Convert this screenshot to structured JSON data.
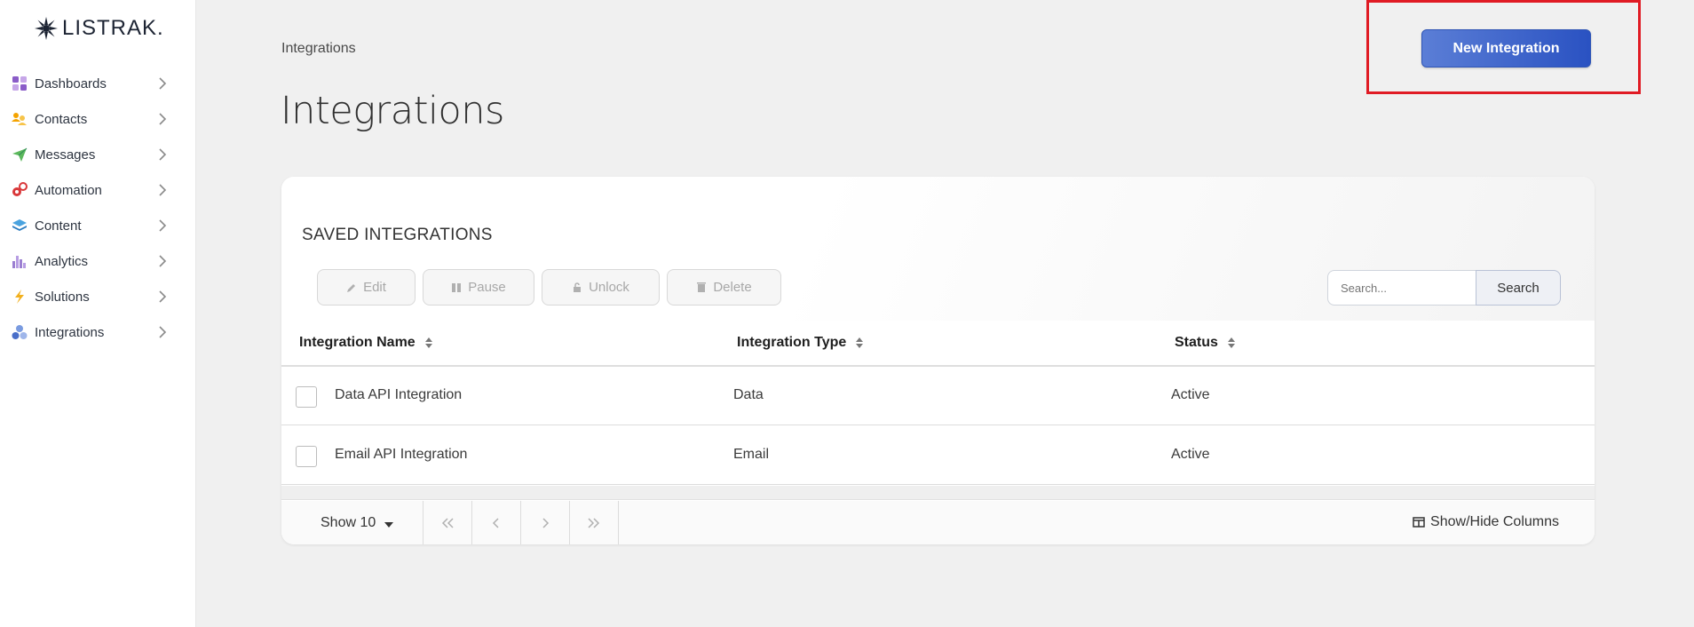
{
  "brand": {
    "name": "LISTRAK."
  },
  "sidebar": {
    "items": [
      {
        "label": "Dashboards",
        "icon": "dashboards-icon"
      },
      {
        "label": "Contacts",
        "icon": "contacts-icon"
      },
      {
        "label": "Messages",
        "icon": "messages-icon"
      },
      {
        "label": "Automation",
        "icon": "automation-icon"
      },
      {
        "label": "Content",
        "icon": "content-icon"
      },
      {
        "label": "Analytics",
        "icon": "analytics-icon"
      },
      {
        "label": "Solutions",
        "icon": "solutions-icon"
      },
      {
        "label": "Integrations",
        "icon": "integrations-icon"
      }
    ]
  },
  "header": {
    "breadcrumb": "Integrations",
    "title": "Integrations",
    "new_button": "New Integration"
  },
  "card": {
    "title": "SAVED INTEGRATIONS",
    "toolbar": {
      "edit": "Edit",
      "pause": "Pause",
      "unlock": "Unlock",
      "delete": "Delete"
    },
    "search": {
      "placeholder": "Search...",
      "button": "Search"
    },
    "columns": [
      "Integration Name",
      "Integration Type",
      "Status"
    ],
    "rows": [
      {
        "name": "Data API Integration",
        "type": "Data",
        "status": "Active"
      },
      {
        "name": "Email API Integration",
        "type": "Email",
        "status": "Active"
      }
    ],
    "footer": {
      "show": "Show 10",
      "columns_toggle": "Show/Hide Columns"
    }
  },
  "colors": {
    "accent": "#2a52c2",
    "highlight": "#e01b24"
  }
}
